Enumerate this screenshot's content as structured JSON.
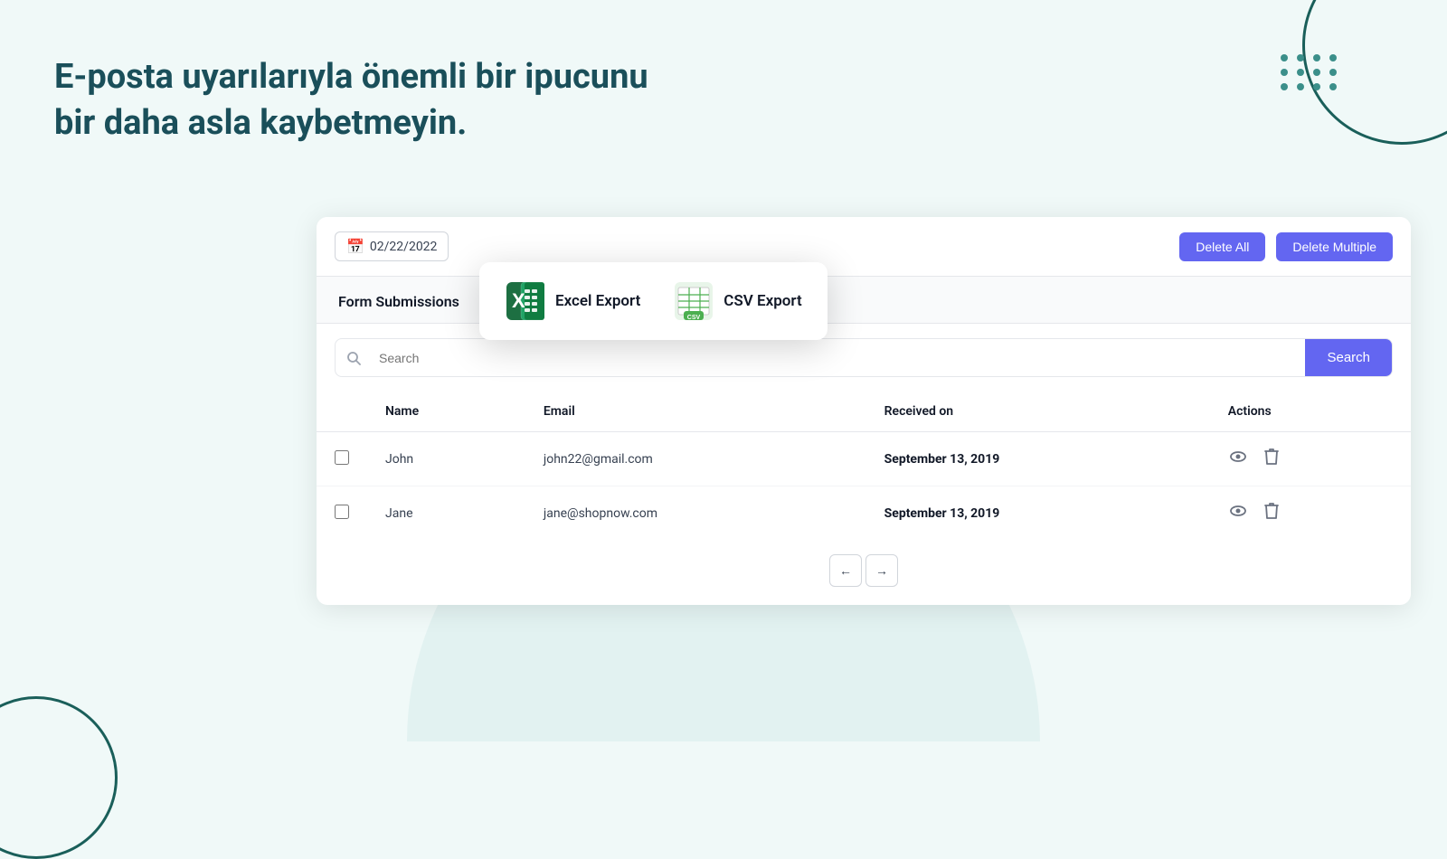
{
  "page": {
    "bg_color": "#f0f9f8"
  },
  "hero": {
    "title": "E-posta uyarılarıyla önemli bir ipucunu bir daha asla kaybetmeyin."
  },
  "toolbar": {
    "date_label": "02/22/2022",
    "delete_all_label": "Delete All",
    "delete_multiple_label": "Delete Multiple"
  },
  "export_dropdown": {
    "excel_label": "Excel Export",
    "csv_label": "CSV Export"
  },
  "section": {
    "title": "Form Submissions"
  },
  "search": {
    "placeholder": "Search",
    "button_label": "Search"
  },
  "table": {
    "columns": [
      "",
      "Name",
      "Email",
      "Received on",
      "Actions"
    ],
    "rows": [
      {
        "id": 1,
        "name": "John",
        "email": "john22@gmail.com",
        "received_on": "September 13, 2019"
      },
      {
        "id": 2,
        "name": "Jane",
        "email": "jane@shopnow.com",
        "received_on": "September 13, 2019"
      }
    ]
  },
  "pagination": {
    "prev_label": "←",
    "next_label": "→"
  }
}
